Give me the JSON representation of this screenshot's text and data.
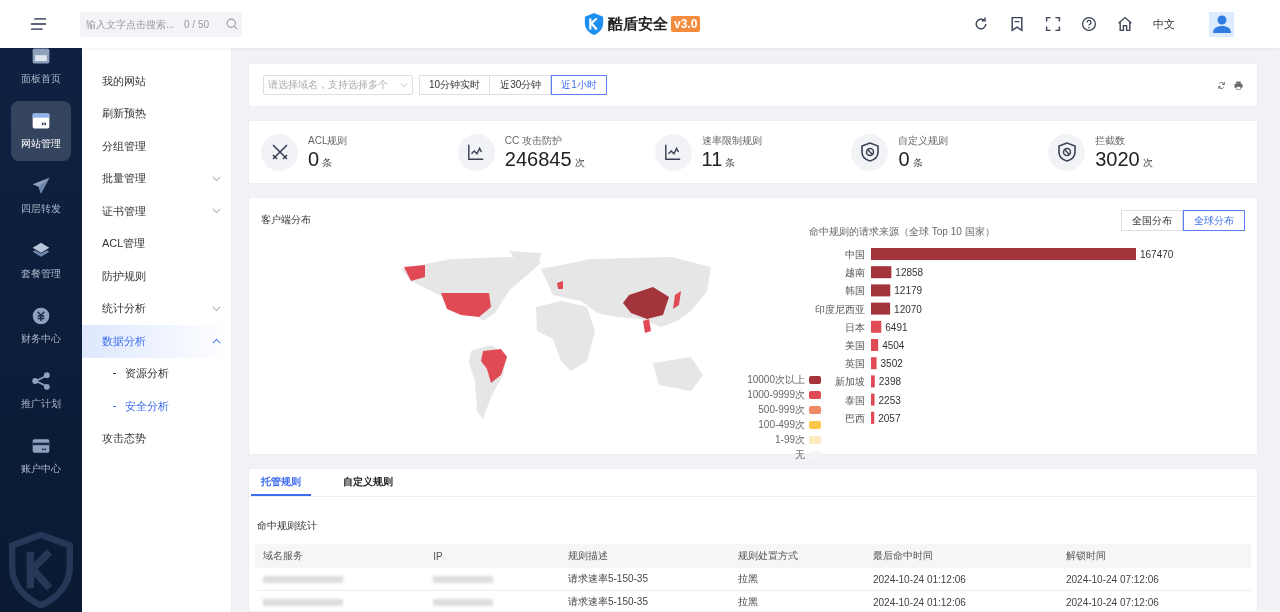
{
  "header": {
    "search": {
      "placeholder": "输入文字点击搜索...",
      "counter": "0 / 50"
    },
    "logo": {
      "name": "酷盾安全",
      "version": "v3.0"
    },
    "language": "中文"
  },
  "nav": [
    {
      "label": "面板首页",
      "kind": "dashboard",
      "selected": false
    },
    {
      "label": "网站管理",
      "kind": "window",
      "selected": true
    },
    {
      "label": "四层转发",
      "kind": "plane",
      "selected": false
    },
    {
      "label": "套餐管理",
      "kind": "layers",
      "selected": false
    },
    {
      "label": "财务中心",
      "kind": "coin",
      "selected": false
    },
    {
      "label": "推广计划",
      "kind": "share",
      "selected": false
    },
    {
      "label": "账户中心",
      "kind": "card",
      "selected": false
    }
  ],
  "submenu": [
    {
      "label": "我的网站",
      "kind": "link",
      "selected": false
    },
    {
      "label": "刷新预热",
      "kind": "link",
      "selected": false
    },
    {
      "label": "分组管理",
      "kind": "link",
      "selected": false
    },
    {
      "label": "批量管理",
      "kind": "group",
      "expanded": false,
      "selected": false
    },
    {
      "label": "证书管理",
      "kind": "group",
      "expanded": false,
      "selected": false
    },
    {
      "label": "ACL管理",
      "kind": "link",
      "selected": false
    },
    {
      "label": "防护规则",
      "kind": "link",
      "selected": false
    },
    {
      "label": "统计分析",
      "kind": "group",
      "expanded": false,
      "selected": false
    },
    {
      "label": "数据分析",
      "kind": "group",
      "expanded": true,
      "selected": true,
      "children": [
        {
          "label": "资源分析",
          "selected": false
        },
        {
          "label": "安全分析",
          "selected": true
        }
      ]
    },
    {
      "label": "攻击态势",
      "kind": "link",
      "selected": false
    }
  ],
  "filter": {
    "domain_placeholder": "请选择域名，支持选择多个",
    "ranges": [
      {
        "label": "10分钟实时",
        "selected": false
      },
      {
        "label": "近30分钟",
        "selected": false
      },
      {
        "label": "近1小时",
        "selected": true
      }
    ]
  },
  "stats": [
    {
      "label": "ACL规则",
      "value": "0",
      "unit": "条",
      "kind": "swords"
    },
    {
      "label": "CC 攻击防护",
      "value": "246845",
      "unit": "次",
      "kind": "chart"
    },
    {
      "label": "速率限制规则",
      "value": "11",
      "unit": "条",
      "kind": "chart"
    },
    {
      "label": "自定义规则",
      "value": "0",
      "unit": "条",
      "kind": "shield"
    },
    {
      "label": "拦截数",
      "value": "3020",
      "unit": "次",
      "kind": "shield"
    }
  ],
  "distribution": {
    "title": "客户端分布",
    "scopes": [
      {
        "label": "全国分布",
        "selected": false
      },
      {
        "label": "全球分布",
        "selected": true
      }
    ],
    "legend": [
      {
        "label": "10000次以上",
        "color": "#a3343b"
      },
      {
        "label": "1000-9999次",
        "color": "#e04a55"
      },
      {
        "label": "500-999次",
        "color": "#f08a65"
      },
      {
        "label": "100-499次",
        "color": "#fcc84a"
      },
      {
        "label": "1-99次",
        "color": "#fde9c0"
      },
      {
        "label": "无",
        "color": "#f5f5f5"
      }
    ],
    "chart_data": {
      "type": "bar",
      "orientation": "horizontal",
      "title": "命中规则的请求来源（全球 Top 10 国家）",
      "data_labels": true,
      "categories": [
        "中国",
        "越南",
        "韩国",
        "印度尼西亚",
        "日本",
        "美国",
        "英国",
        "新加坡",
        "泰国",
        "巴西"
      ],
      "values": [
        167470,
        12858,
        12179,
        12070,
        6491,
        4504,
        3502,
        2398,
        2253,
        2057
      ]
    }
  },
  "rules": {
    "tabs": [
      {
        "label": "托管规则",
        "selected": true
      },
      {
        "label": "自定义规则",
        "selected": false
      }
    ],
    "title": "命中规则统计",
    "columns": [
      "域名服务",
      "IP",
      "规则描述",
      "规则处置方式",
      "最后命中时间",
      "解锁时间"
    ],
    "rows": [
      {
        "description": "请求速率5-150-35",
        "action": "拉黑",
        "last_hit": "2024-10-24 01:12:06",
        "unlock": "2024-10-24 07:12:06"
      },
      {
        "description": "请求速率5-150-35",
        "action": "拉黑",
        "last_hit": "2024-10-24 01:12:06",
        "unlock": "2024-10-24 07:12:06"
      }
    ]
  }
}
